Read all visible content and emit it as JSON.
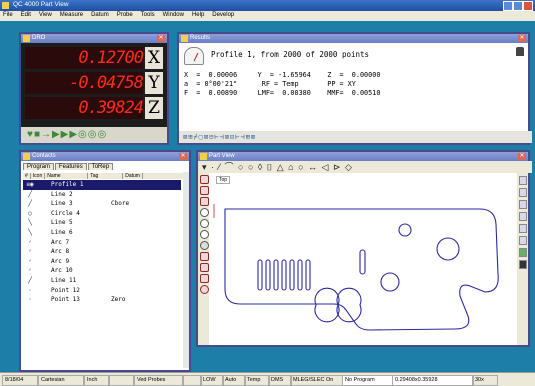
{
  "app": {
    "title": "QC 4000 Part View"
  },
  "menu": [
    "File",
    "Edit",
    "View",
    "Measure",
    "Datum",
    "Probe",
    "Tools",
    "Window",
    "Help",
    "Develop"
  ],
  "dro": {
    "title": "DRO",
    "rows": [
      {
        "value": "0.12700",
        "axis": "X"
      },
      {
        "value": "-0.04758",
        "axis": "Y"
      },
      {
        "value": "0.39824",
        "axis": "Z"
      }
    ],
    "toolbar_glyphs": "♥■→▶▶▶◎◎◎"
  },
  "results": {
    "title": "Results",
    "heading": "Profile 1, from 2000 of 2000 points",
    "lines": [
      "X  =  0.00006     Y  = -1.65964    Z  =  0.00000",
      "a  = 0°00'21\"      RF = Temp       PP = XY",
      "F  =  0.00890     LMF=  0.00380    MMF=  0.00510"
    ],
    "toolbar_glyphs": "⊠⊞⌿▢⊠⊟⊢⊣⊠⊡⊢⊣⊞⊠"
  },
  "contacts": {
    "title": "Contacts",
    "tabs": [
      "Program",
      "Features",
      "ToRep"
    ],
    "columns": [
      "#",
      "Icon",
      "Name",
      "Tag",
      "Datum"
    ],
    "rows": [
      {
        "icon": "≡◉",
        "name": "Profile 1",
        "tag": "",
        "selected": true
      },
      {
        "icon": "╱",
        "name": "Line 2",
        "tag": ""
      },
      {
        "icon": "╱",
        "name": "Line 3",
        "tag": "Cbore"
      },
      {
        "icon": "○",
        "name": "Circle 4",
        "tag": ""
      },
      {
        "icon": "╲",
        "name": "Line 5",
        "tag": ""
      },
      {
        "icon": "╲",
        "name": "Line 6",
        "tag": ""
      },
      {
        "icon": "◜",
        "name": "Arc 7",
        "tag": ""
      },
      {
        "icon": "◜",
        "name": "Arc 8",
        "tag": ""
      },
      {
        "icon": "◜",
        "name": "Arc 9",
        "tag": ""
      },
      {
        "icon": "◜",
        "name": "Arc 10",
        "tag": ""
      },
      {
        "icon": "╱",
        "name": "Line 11",
        "tag": ""
      },
      {
        "icon": "·",
        "name": "Point 12",
        "tag": ""
      },
      {
        "icon": "·",
        "name": "Point 13",
        "tag": "Zero"
      }
    ]
  },
  "partview": {
    "title": "Part View",
    "toolbar_glyphs": "▾ · ⁄ ⌒ ○ ○ ◊ ⌷ △ ⌂ ○ ↔ ◁ ⊳ ◇",
    "view_label": "Top"
  },
  "status": {
    "items": [
      "8/18/04",
      "Cartesian",
      "Inch",
      "",
      "Ved Probes",
      "",
      "LOW",
      "Auto",
      "Temp",
      "DMS",
      "MLEG/SLEC On",
      "No Program",
      "0.29408x0.35928",
      "30x"
    ]
  },
  "colors": {
    "desktop": "#1d7ea8",
    "dro_digits": "#ff2a1a",
    "selection": "#1a1a6a"
  }
}
